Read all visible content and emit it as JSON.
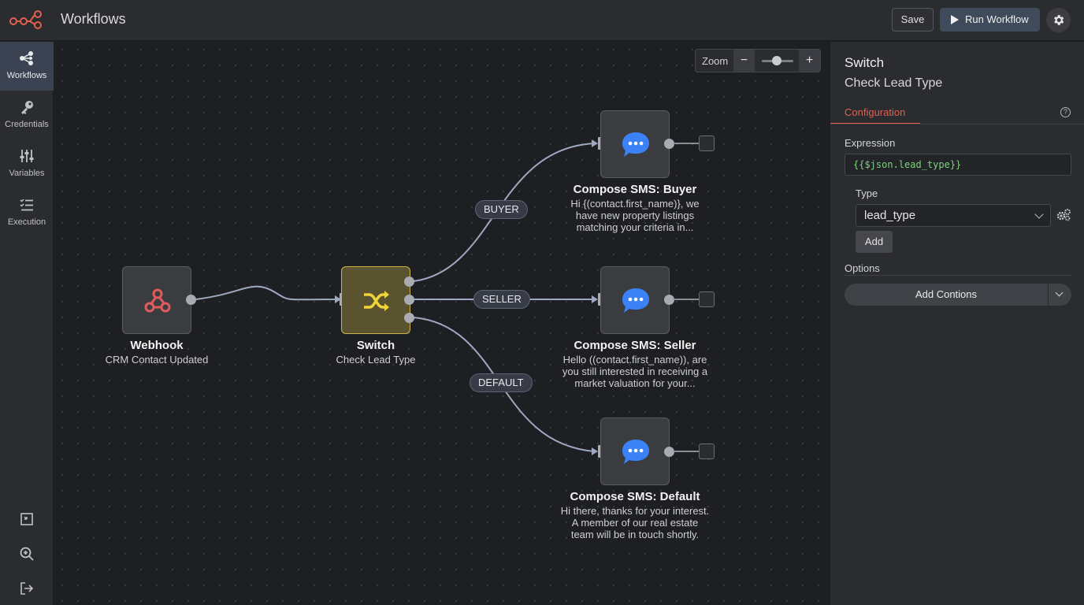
{
  "topbar": {
    "title": "Workflows",
    "save_label": "Save",
    "run_label": "Run Workflow"
  },
  "sidebar": {
    "items": [
      {
        "label": "Workflows",
        "icon": "workflows-icon",
        "active": true
      },
      {
        "label": "Credentials",
        "icon": "key-icon",
        "active": false
      },
      {
        "label": "Variables",
        "icon": "sliders-icon",
        "active": false
      },
      {
        "label": "Execution",
        "icon": "list-icon",
        "active": false
      }
    ],
    "bottom_icons": [
      "fit-view-icon",
      "zoom-in-icon",
      "logout-icon"
    ]
  },
  "canvas": {
    "zoom_label": "Zoom",
    "zoom_minus": "−",
    "zoom_plus": "+",
    "nodes": {
      "webhook": {
        "title": "Webhook",
        "subtitle": "CRM Contact Updated",
        "icon": "webhook-icon"
      },
      "switch": {
        "title": "Switch",
        "subtitle": "Check Lead Type",
        "icon": "shuffle-icon"
      },
      "buyer": {
        "title": "Compose SMS: Buyer",
        "subtitle_lines": [
          "Hi {(contact.first_name)}, we",
          "have new property listings",
          "matching your criteria in..."
        ],
        "icon": "chat-icon"
      },
      "seller": {
        "title": "Compose SMS: Seller",
        "subtitle_lines": [
          "Hello ((contact.first_name)), are",
          "you still interested in receiving a",
          "market valuation for your..."
        ],
        "icon": "chat-icon"
      },
      "default": {
        "title": "Compose SMS: Default",
        "subtitle_lines": [
          "Hi there, thanks for your interest.",
          "A member of our real estate",
          "team will be in touch shortly."
        ],
        "icon": "chat-icon"
      }
    },
    "edge_labels": {
      "buyer": "BUYER",
      "seller": "SELLER",
      "default": "DEFAULT"
    }
  },
  "panel": {
    "title": "Switch",
    "subtitle": "Check Lead Type",
    "tab_configuration": "Configuration",
    "expression_label": "Expression",
    "expression_value": "{{$json.lead_type}}",
    "type_label": "Type",
    "type_value": "lead_type",
    "add_label": "Add",
    "options_label": "Options",
    "add_conditions_label": "Add Contions"
  },
  "colors": {
    "accent": "#e2604f",
    "switch_node": "#5a5330",
    "edge": "#9ea8c0",
    "chat_icon": "#3b82f6",
    "webhook_icon": "#e05c5c"
  }
}
